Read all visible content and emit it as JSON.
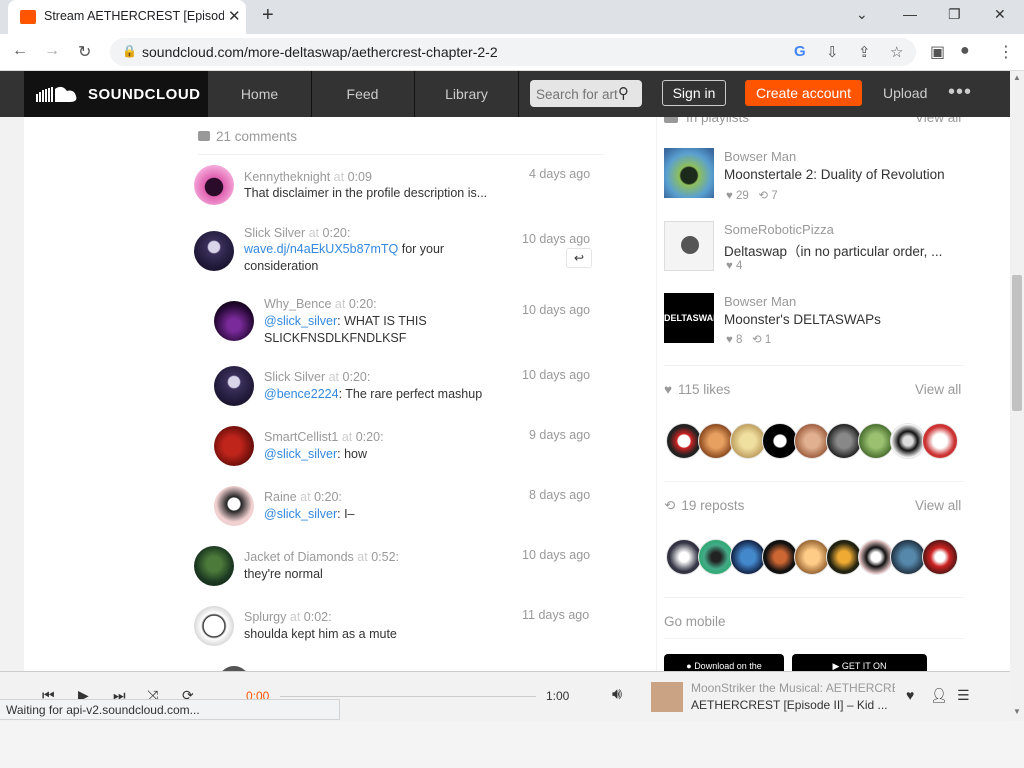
{
  "browser": {
    "tab_title": "Stream AETHERCREST [Episode II]",
    "tab_close": "✕",
    "new_tab": "+",
    "url": "soundcloud.com/more-deltaswap/aethercrest-chapter-2-2",
    "status": "Waiting for api-v2.soundcloud.com..."
  },
  "header": {
    "logo": "SOUNDCLOUD",
    "nav": [
      "Home",
      "Feed",
      "Library"
    ],
    "search_placeholder": "Search for artists",
    "sign_in": "Sign in",
    "create_account": "Create account",
    "upload": "Upload",
    "more": "•••"
  },
  "comments": {
    "count_label": "21 comments",
    "items": [
      {
        "user": "Kennytheknight",
        "at": "at",
        "time": "0:09",
        "text": "That disclaimer in the profile description is...",
        "date": "4 days ago"
      },
      {
        "user": "Slick Silver",
        "at": "at",
        "time": "0:20:",
        "link": "wave.dj/n4aEkUX5b87mTQ",
        "text": " for your consideration",
        "date": "10 days ago"
      },
      {
        "user": "Why_Bence",
        "at": "at",
        "time": "0:20:",
        "mention": "@slick_silver",
        "text": ": WHAT IS THIS SLICKFNSDLKFNDLKSF",
        "date": "10 days ago"
      },
      {
        "user": "Slick Silver",
        "at": "at",
        "time": "0:20:",
        "mention": "@bence2224",
        "text": ": The rare perfect mashup",
        "date": "10 days ago"
      },
      {
        "user": "SmartCellist1",
        "at": "at",
        "time": "0:20:",
        "mention": "@slick_silver",
        "text": ": how",
        "date": "9 days ago"
      },
      {
        "user": "Raine",
        "at": "at",
        "time": "0:20:",
        "mention": "@slick_silver",
        "text": ": I–",
        "date": "8 days ago"
      },
      {
        "user": "Jacket of Diamonds",
        "at": "at",
        "time": "0:52:",
        "text": "they're normal",
        "date": "10 days ago"
      },
      {
        "user": "Splurgy",
        "at": "at",
        "time": "0:02:",
        "text": "shoulda kept him as a mute",
        "date": "11 days ago"
      }
    ]
  },
  "sidebar": {
    "playlists_label": "In playlists",
    "view_all": "View all",
    "playlists": [
      {
        "user": "Bowser Man",
        "title": "Moonstertale 2: Duality of Revolution",
        "likes": "29",
        "reposts": "7"
      },
      {
        "user": "SomeRoboticPizza",
        "title": "Deltaswap（in no particular order, ...",
        "likes": "4"
      },
      {
        "user": "Bowser Man",
        "title": "Moonster's DELTASWAPs",
        "likes": "8",
        "reposts": "1",
        "art_text": "DELTASWAP"
      }
    ],
    "likes_label": "115 likes",
    "reposts_label": "19 reposts",
    "go_mobile": "Go mobile",
    "app_store": "Download on the",
    "google_play": "GET IT ON"
  },
  "player": {
    "current": "0:00",
    "duration": "1:00",
    "artist": "MoonStriker the Musical: AETHERCREST",
    "title": "AETHERCREST [Episode II] – Kid ..."
  }
}
